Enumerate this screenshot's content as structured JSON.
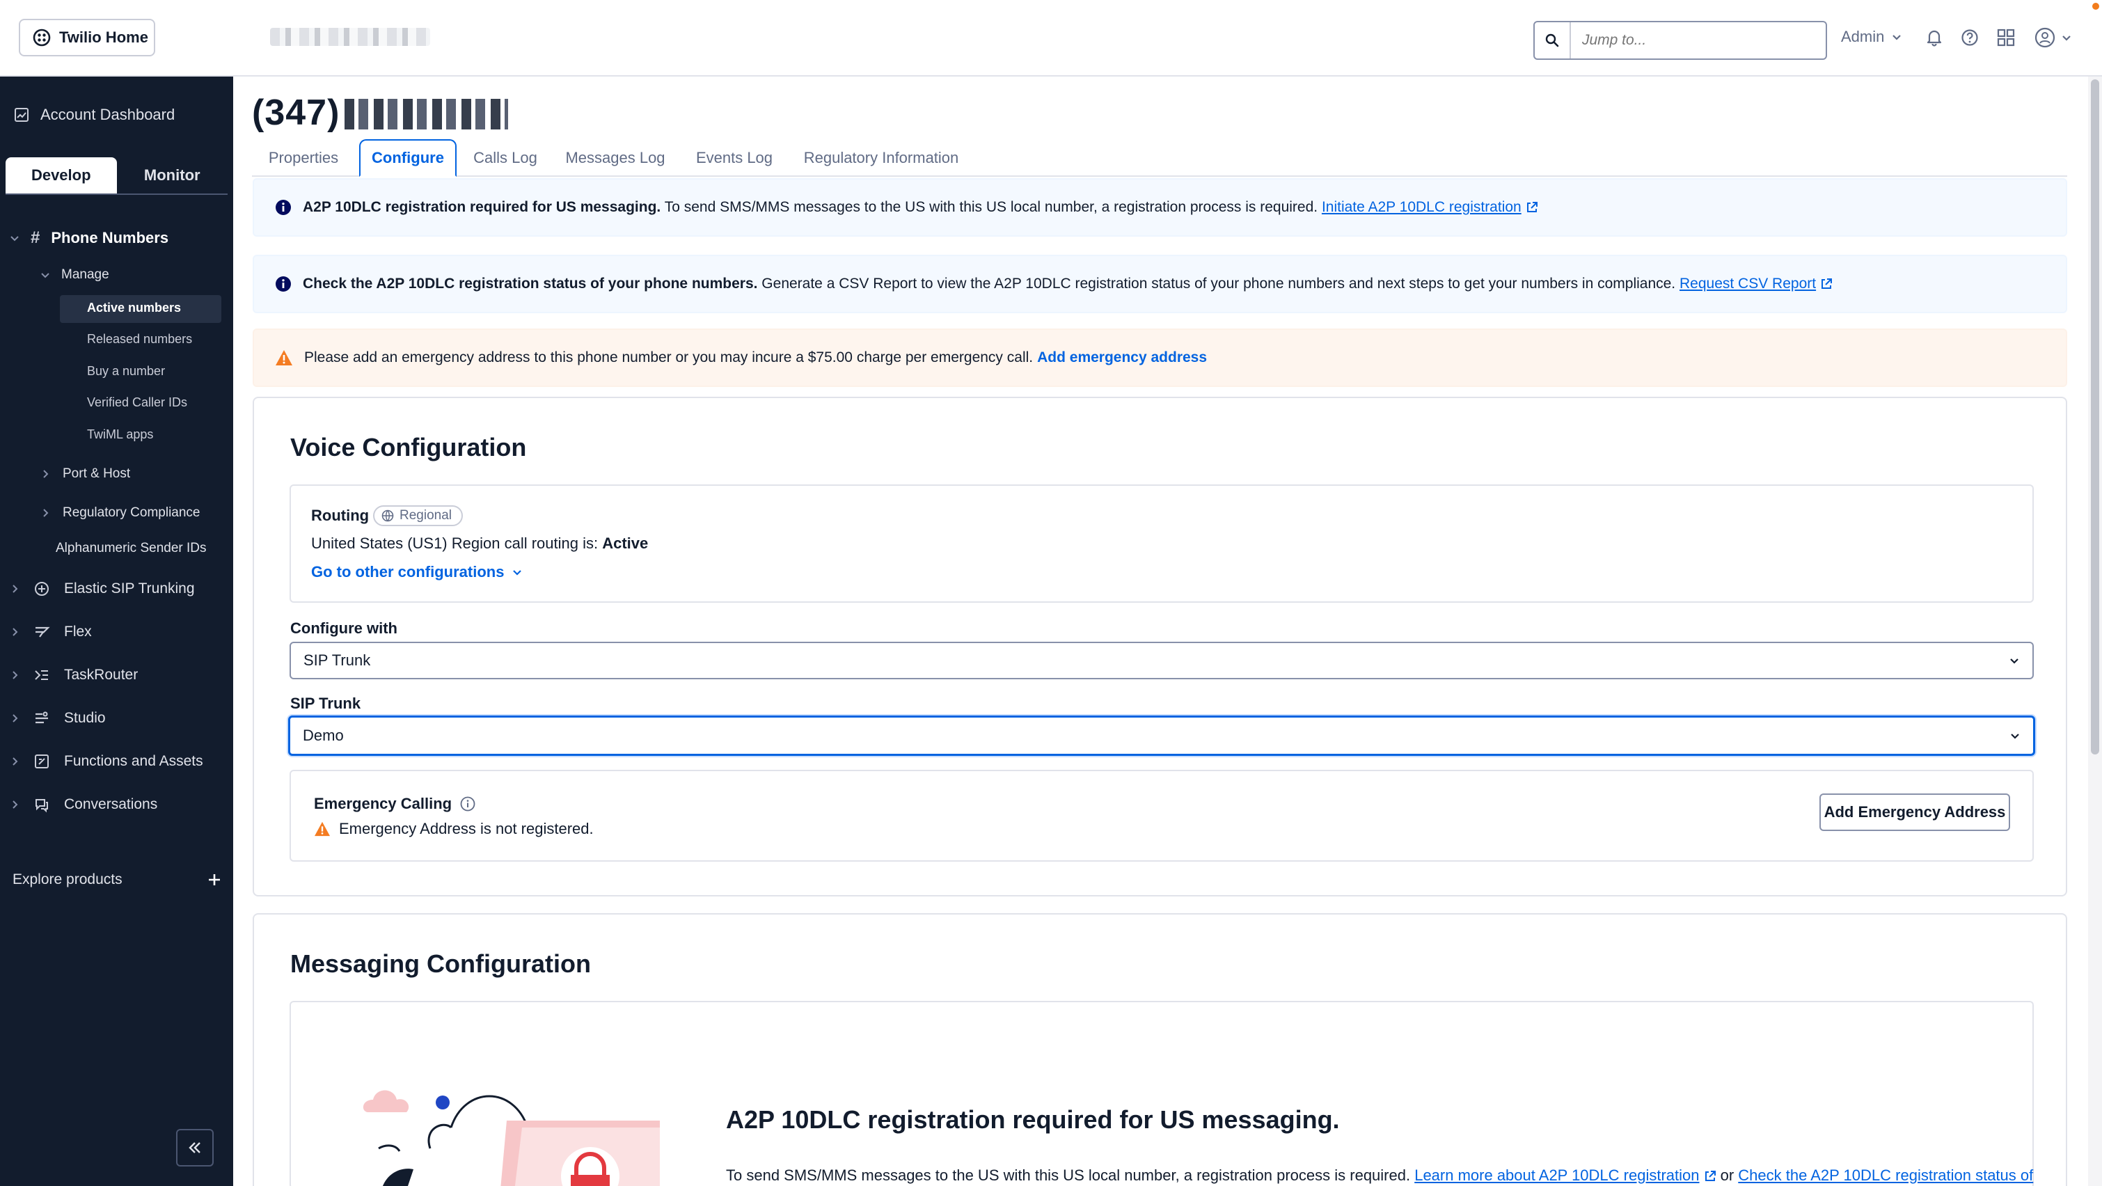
{
  "topbar": {
    "home_label": "Twilio Home",
    "search_placeholder": "Jump to...",
    "role": "Admin"
  },
  "sidebar": {
    "dashboard": "Account Dashboard",
    "tabs": [
      "Develop",
      "Monitor"
    ],
    "phone_numbers": "Phone Numbers",
    "manage": "Manage",
    "manage_items": [
      "Active numbers",
      "Released numbers",
      "Buy a number",
      "Verified Caller IDs",
      "TwiML apps"
    ],
    "port_host": "Port & Host",
    "regulatory_compliance": "Regulatory Compliance",
    "alphanumeric": "Alphanumeric Sender IDs",
    "products": [
      "Elastic SIP Trunking",
      "Flex",
      "TaskRouter",
      "Studio",
      "Functions and Assets",
      "Conversations"
    ],
    "explore": "Explore products"
  },
  "page": {
    "title_prefix": "(347)",
    "tabs": [
      "Properties",
      "Configure",
      "Calls Log",
      "Messages Log",
      "Events Log",
      "Regulatory Information"
    ]
  },
  "banners": {
    "a2p": {
      "bold": "A2P 10DLC registration required for US messaging.",
      "text": " To send SMS/MMS messages to the US with this US local number, a registration process is required. ",
      "link": "Initiate A2P 10DLC registration"
    },
    "status": {
      "bold": "Check the A2P 10DLC registration status of your phone numbers.",
      "text": " Generate a CSV Report to view the A2P 10DLC registration status of your phone numbers and next steps to get your numbers in compliance. ",
      "link": "Request CSV Report"
    },
    "emergency": {
      "text": "Please add an emergency address to this phone number or you may incure a $75.00 charge per emergency call.",
      "link": "Add emergency address"
    }
  },
  "voice": {
    "heading": "Voice Configuration",
    "routing_label": "Routing",
    "routing_badge": "Regional",
    "routing_text": "United States (US1) Region call routing is: ",
    "routing_status": "Active",
    "other_configs": "Go to other configurations",
    "configure_with_label": "Configure with",
    "configure_with_value": "SIP Trunk",
    "sip_trunk_label": "SIP Trunk",
    "sip_trunk_value": "Demo",
    "emergency_label": "Emergency Calling",
    "emergency_status": "Emergency Address is not registered.",
    "emergency_button": "Add Emergency Address"
  },
  "messaging": {
    "heading": "Messaging Configuration",
    "a2p_heading": "A2P 10DLC registration required for US messaging.",
    "a2p_text": "To send SMS/MMS messages to the US with this US local number, a registration process is required. ",
    "a2p_link1": "Learn more about A2P 10DLC registration",
    "a2p_or": " or ",
    "a2p_link2": "Check the A2P 10DLC registration status of"
  },
  "colors": {
    "sidebar_bg": "#121c2d",
    "accent": "#0263e0",
    "warning": "#f47c22",
    "info_bg": "#f4f9ff",
    "warn_bg": "#fef5ee"
  }
}
